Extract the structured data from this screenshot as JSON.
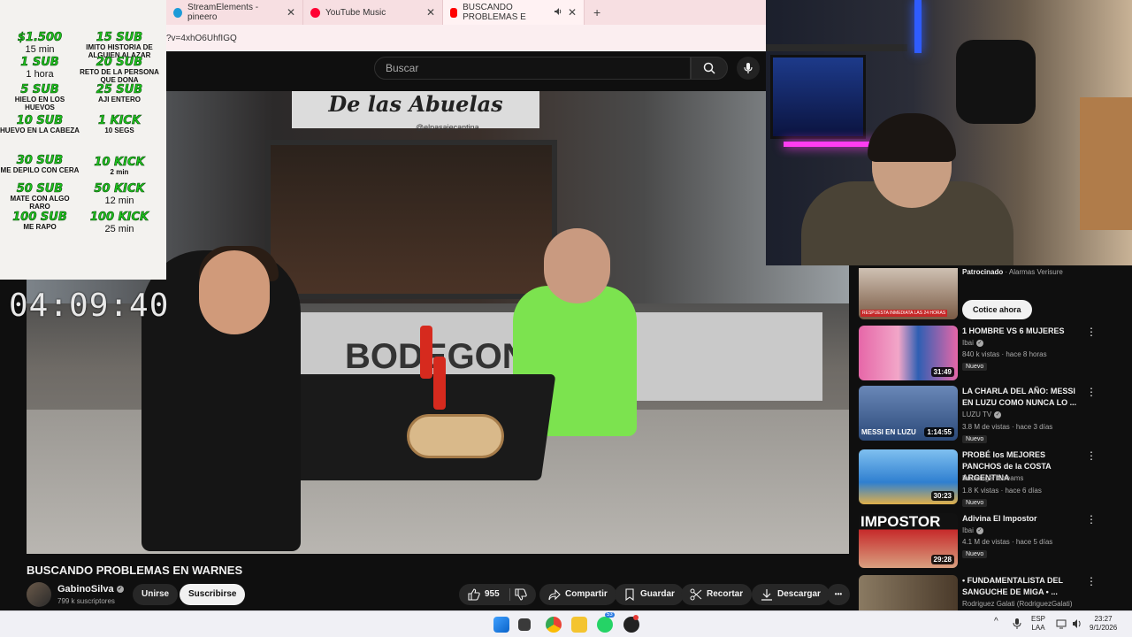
{
  "browser": {
    "tabs": [
      {
        "label": "StreamElements - pineero",
        "active": false
      },
      {
        "label": "YouTube Music",
        "active": false
      },
      {
        "label": "BUSCANDO PROBLEMAS E",
        "active": true
      }
    ],
    "url_fragment": "?v=4xhO6UhfIGQ",
    "new_tab_glyph": "+",
    "close_glyph": "✕"
  },
  "youtube": {
    "search_placeholder": "Buscar",
    "video": {
      "sign_text": "De las Abuelas",
      "sign_handle": "@elpasajecantina",
      "wall_text": "BODEGON"
    },
    "title": "BUSCANDO PROBLEMAS EN WARNES",
    "channel": {
      "name": "GabinoSilva",
      "subscribers": "799 k suscriptores"
    },
    "buttons": {
      "join": "Unirse",
      "subscribe": "Suscribirse"
    },
    "actions": {
      "likes": "955",
      "share": "Compartir",
      "save": "Guardar",
      "clip": "Recortar",
      "download": "Descargar",
      "more": "•••"
    },
    "sidebar": {
      "sponsored_label": "Patrocinado",
      "sponsor_name": "Alarmas Verisure",
      "ad_thumb_text": "RESPUESTA INMEDIATA LAS 24 HORAS",
      "cta": "Cotice ahora",
      "items": [
        {
          "title": "1 HOMBRE VS 6 MUJERES",
          "channel": "Ibai",
          "verified": true,
          "meta": "840 k vistas · hace 8 horas",
          "badge": "Nuevo",
          "duration": "31:49",
          "thumb_color": "#d84a8a"
        },
        {
          "title": "LA CHARLA DEL AÑO: MESSI EN LUZU COMO NUNCA LO ...",
          "channel": "LUZU TV",
          "verified": true,
          "meta": "3.8 M de vistas · hace 3 días",
          "badge": "Nuevo",
          "duration": "1:14:55",
          "thumb_color": "#2c4a7a",
          "thumb_caption": "MESSI EN LUZU"
        },
        {
          "title": "PROBÉ los MEJORES PANCHOS de la COSTA ARGENTINA",
          "channel": "Brunenger Streams",
          "verified": false,
          "meta": "1.8 K vistas · hace 6 días",
          "badge": "Nuevo",
          "duration": "30:23",
          "thumb_color": "#2f7fd0"
        },
        {
          "title": "Adivina El Impostor",
          "channel": "Ibai",
          "verified": true,
          "meta": "4.1 M de vistas · hace 5 días",
          "badge": "Nuevo",
          "duration": "29:28",
          "thumb_color": "#c62a2a",
          "thumb_caption": "IMPOSTOR"
        },
        {
          "title": "• FUNDAMENTALISTA DEL SANGUCHE DE MIGA • ...",
          "channel": "Rodriguez Galati (RodriguezGalati)",
          "verified": false,
          "meta": "",
          "badge": "",
          "duration": "",
          "thumb_color": "#6b5a44"
        }
      ]
    }
  },
  "stream_overlay": {
    "timer": "04:09:40",
    "goals": [
      {
        "key": "$1.500",
        "value": "15 min",
        "big": true
      },
      {
        "key": "15 SUB",
        "value": "IMITO HISTORIA DE ALGUIEN ALAZAR",
        "big": false
      },
      {
        "key": "1 SUB",
        "value": "1 hora",
        "big": true
      },
      {
        "key": "20 SUB",
        "value": "RETO DE LA PERSONA QUE DONA",
        "big": false
      },
      {
        "key": "5 SUB",
        "value": "HIELO EN LOS HUEVOS",
        "big": false
      },
      {
        "key": "25 SUB",
        "value": "AJI ENTERO",
        "big": false
      },
      {
        "key": "10 SUB",
        "value": "HUEVO EN LA CABEZA",
        "big": false
      },
      {
        "key": "1 KICK",
        "value": "10 SEGS",
        "big": false
      },
      {
        "key": "30 SUB",
        "value": "ME DEPILO CON CERA",
        "big": false
      },
      {
        "key": "10 KICK",
        "value": "2 min",
        "big": false
      },
      {
        "key": "50 SUB",
        "value": "MATE CON ALGO RARO",
        "big": false
      },
      {
        "key": "50 KICK",
        "value": "12 min",
        "big": true
      },
      {
        "key": "100 SUB",
        "value": "ME RAPO",
        "big": false
      },
      {
        "key": "100 KICK",
        "value": "25 min",
        "big": true
      }
    ]
  },
  "taskbar": {
    "language": "ESP",
    "layout": "LAA",
    "time": "23:27",
    "date": "9/1/2026",
    "whatsapp_badge": "53",
    "tray_up_glyph": "^"
  },
  "colors": {
    "yt_bg": "#0f0f0f",
    "goal_green": "#1ec61e",
    "brand_red": "#ff0000",
    "kick_green": "#53fc18"
  },
  "icons": [
    "search-icon",
    "mic-icon",
    "like-icon",
    "dislike-icon",
    "share-icon",
    "save-icon",
    "clip-icon",
    "download-icon",
    "more-icon",
    "windows-start-icon",
    "chrome-icon",
    "folder-icon",
    "whatsapp-icon",
    "obs-icon"
  ]
}
